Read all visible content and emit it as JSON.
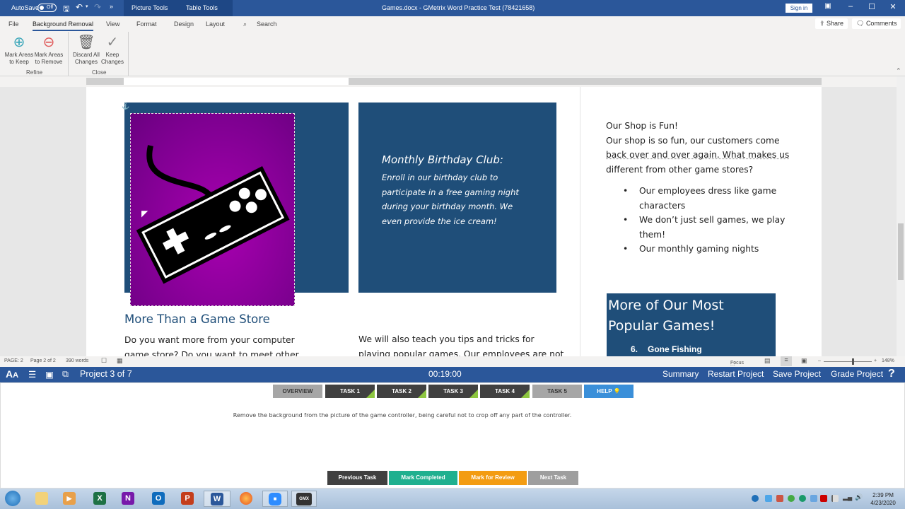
{
  "titlebar": {
    "autosave_label": "AutoSave",
    "autosave_state": "Off",
    "context_tabs": [
      "Picture Tools",
      "Table Tools"
    ],
    "title": "Games.docx  -   GMetrix Word Practice Test (78421658)",
    "sign_in": "Sign in"
  },
  "ribbon": {
    "tabs": [
      "File",
      "Background Removal",
      "View",
      "Format",
      "Design",
      "Layout"
    ],
    "active_tab": "Background Removal",
    "search": "Search",
    "share": "Share",
    "comments": "Comments",
    "buttons": [
      {
        "label1": "Mark Areas",
        "label2": "to Keep",
        "icon": "mark-keep-icon"
      },
      {
        "label1": "Mark Areas",
        "label2": "to Remove",
        "icon": "mark-remove-icon"
      },
      {
        "label1": "Discard All",
        "label2": "Changes",
        "icon": "trash-icon"
      },
      {
        "label1": "Keep",
        "label2": "Changes",
        "icon": "checkmark-icon"
      }
    ],
    "groups": [
      "Refine",
      "Close"
    ]
  },
  "document": {
    "birthday_title": "Monthly Birthday Club:",
    "birthday_lines": [
      "Enroll in our birthday club to",
      "participate in a free gaming night",
      "during your birthday month.  We",
      "even provide the ice cream!"
    ],
    "shop_heading": "Our Shop is Fun!",
    "shop_lines": [
      "Our shop is so fun, our customers come",
      "back over and over again.  What makes us",
      "different from other game stores?"
    ],
    "bullets": [
      [
        "Our employees dress like game",
        "characters"
      ],
      [
        "We don’t just sell games, we play",
        "them!"
      ],
      [
        "Our monthly gaming nights"
      ]
    ],
    "more_than_heading": "More Than a Game Store",
    "left_para": [
      "Do you want more from your computer",
      "game store?  Do you want to meet other"
    ],
    "mid_para": [
      "We will also teach you tips and tricks for",
      "playing popular games.  Our employees are not"
    ],
    "popular_heading_1": "More of Our Most",
    "popular_heading_2": "Popular Games!",
    "popular_item_num": "6.",
    "popular_item": "Gone Fishing"
  },
  "statusbar": {
    "page": "PAGE: 2",
    "page_of": "Page 2 of 2",
    "words": "390 words",
    "focus": "Focus",
    "zoom": "148%",
    "zoom_fraction": 0.6
  },
  "gmetrix": {
    "project": "Project 3 of 7",
    "timer": "00:19:00",
    "actions": [
      "Summary",
      "Restart Project",
      "Save Project",
      "Grade Project"
    ],
    "help_glyph": "?",
    "tasks": [
      {
        "label": "OVERVIEW",
        "state": "neutral"
      },
      {
        "label": "TASK 1",
        "state": "done"
      },
      {
        "label": "TASK 2",
        "state": "done"
      },
      {
        "label": "TASK 3",
        "state": "done"
      },
      {
        "label": "TASK 4",
        "state": "done"
      },
      {
        "label": "TASK 5",
        "state": "current"
      },
      {
        "label": "HELP",
        "state": "help"
      }
    ],
    "instruction": "Remove the background from the picture of the game controller, being careful not to crop off any part of the controller.",
    "footer_buttons": [
      "Previous Task",
      "Mark Completed",
      "Mark for Review",
      "Next Task"
    ],
    "colors": {
      "done": "#404040",
      "neutral": "#a6a6a6",
      "help": "#3a8fd9",
      "completed": "#1fb08f",
      "review": "#f39c12",
      "next": "#9e9e9e",
      "check": "#8dc63f"
    }
  },
  "taskbar": {
    "apps": [
      {
        "name": "start-button",
        "glyph": ""
      },
      {
        "name": "file-explorer",
        "glyph": ""
      },
      {
        "name": "media-player",
        "glyph": "▶"
      },
      {
        "name": "excel",
        "glyph": "X"
      },
      {
        "name": "onenote",
        "glyph": "N"
      },
      {
        "name": "outlook",
        "glyph": "O"
      },
      {
        "name": "powerpoint",
        "glyph": "P"
      },
      {
        "name": "word",
        "glyph": "W"
      },
      {
        "name": "firefox",
        "glyph": ""
      },
      {
        "name": "zoom",
        "glyph": "■"
      },
      {
        "name": "gmetrix",
        "glyph": "GMX"
      }
    ],
    "time": "2:39 PM",
    "date": "4/23/2020"
  }
}
